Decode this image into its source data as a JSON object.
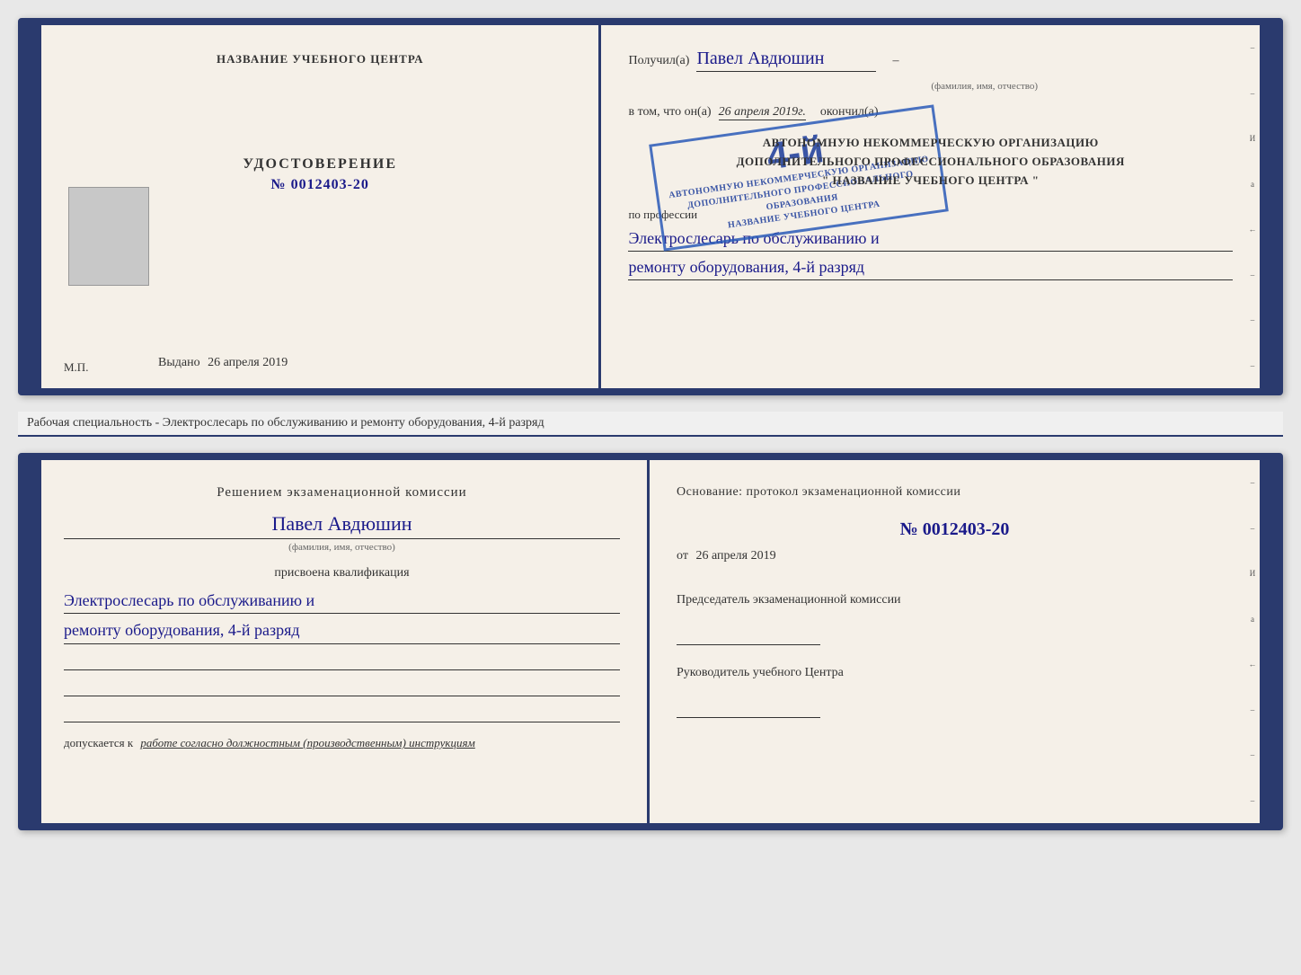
{
  "top_document": {
    "left_page": {
      "school_name_header": "НАЗВАНИЕ УЧЕБНОГО ЦЕНТРА",
      "certificate_title": "УДОСТОВЕРЕНИЕ",
      "certificate_number": "№ 0012403-20",
      "issued_label": "Выдано",
      "issued_date": "26 апреля 2019"
    },
    "right_page": {
      "recipient_label": "Получил(а)",
      "recipient_name": "Павел Авдюшин",
      "name_subtitle": "(фамилия, имя, отчество)",
      "in_that_label": "в том, что он(а)",
      "completion_date": "26 апреля 2019г.",
      "completed_label": "окончил(а)",
      "org_line1": "АВТОНОМНУЮ НЕКОММЕРЧЕСКУЮ ОРГАНИЗАЦИЮ",
      "org_line2": "ДОПОЛНИТЕЛЬНОГО ПРОФЕССИОНАЛЬНОГО ОБРАЗОВАНИЯ",
      "org_name": "\" НАЗВАНИЕ УЧЕБНОГО ЦЕНТРА \"",
      "profession_label": "по профессии",
      "profession_line1": "Электрослесарь по обслуживанию и",
      "profession_line2": "ремонту оборудования, 4-й разряд",
      "stamp_number": "4-й",
      "stamp_text1": "АВТОНОМНУЮ НЕКОММЕРЧЕСКУЮ ОРГАНИЗАЦИЮ",
      "stamp_text2": "ДОПОЛНИТЕЛЬНОГО ПРОФЕССИОНАЛЬНОГО ОБРАЗОВАНИЯ",
      "stamp_text3": "НАЗВАНИЕ УЧЕБНОГО ЦЕНТРА"
    }
  },
  "separator": {
    "text": "Рабочая специальность - Электрослесарь по обслуживанию и ремонту оборудования, 4-й разряд"
  },
  "bottom_document": {
    "left_page": {
      "commission_heading": "Решением экзаменационной комиссии",
      "person_name": "Павел Авдюшин",
      "name_subtitle": "(фамилия, имя, отчество)",
      "qualification_label": "присвоена квалификация",
      "qual_line1": "Электрослесарь по обслуживанию и",
      "qual_line2": "ремонту оборудования, 4-й разряд",
      "допускается_label": "допускается к",
      "допускается_value": "работе согласно должностным (производственным) инструкциям"
    },
    "right_page": {
      "osnov_heading": "Основание: протокол экзаменационной комиссии",
      "protocol_number": "№  0012403-20",
      "from_label": "от",
      "from_date": "26 апреля 2019",
      "chairman_title": "Председатель экзаменационной комиссии",
      "head_title": "Руководитель учебного Центра"
    }
  },
  "side_marks": {
    "И": "И",
    "а": "а",
    "left_arrow": "←",
    "dashes": [
      "–",
      "–",
      "–",
      "–",
      "–",
      "–",
      "–",
      "–"
    ]
  }
}
